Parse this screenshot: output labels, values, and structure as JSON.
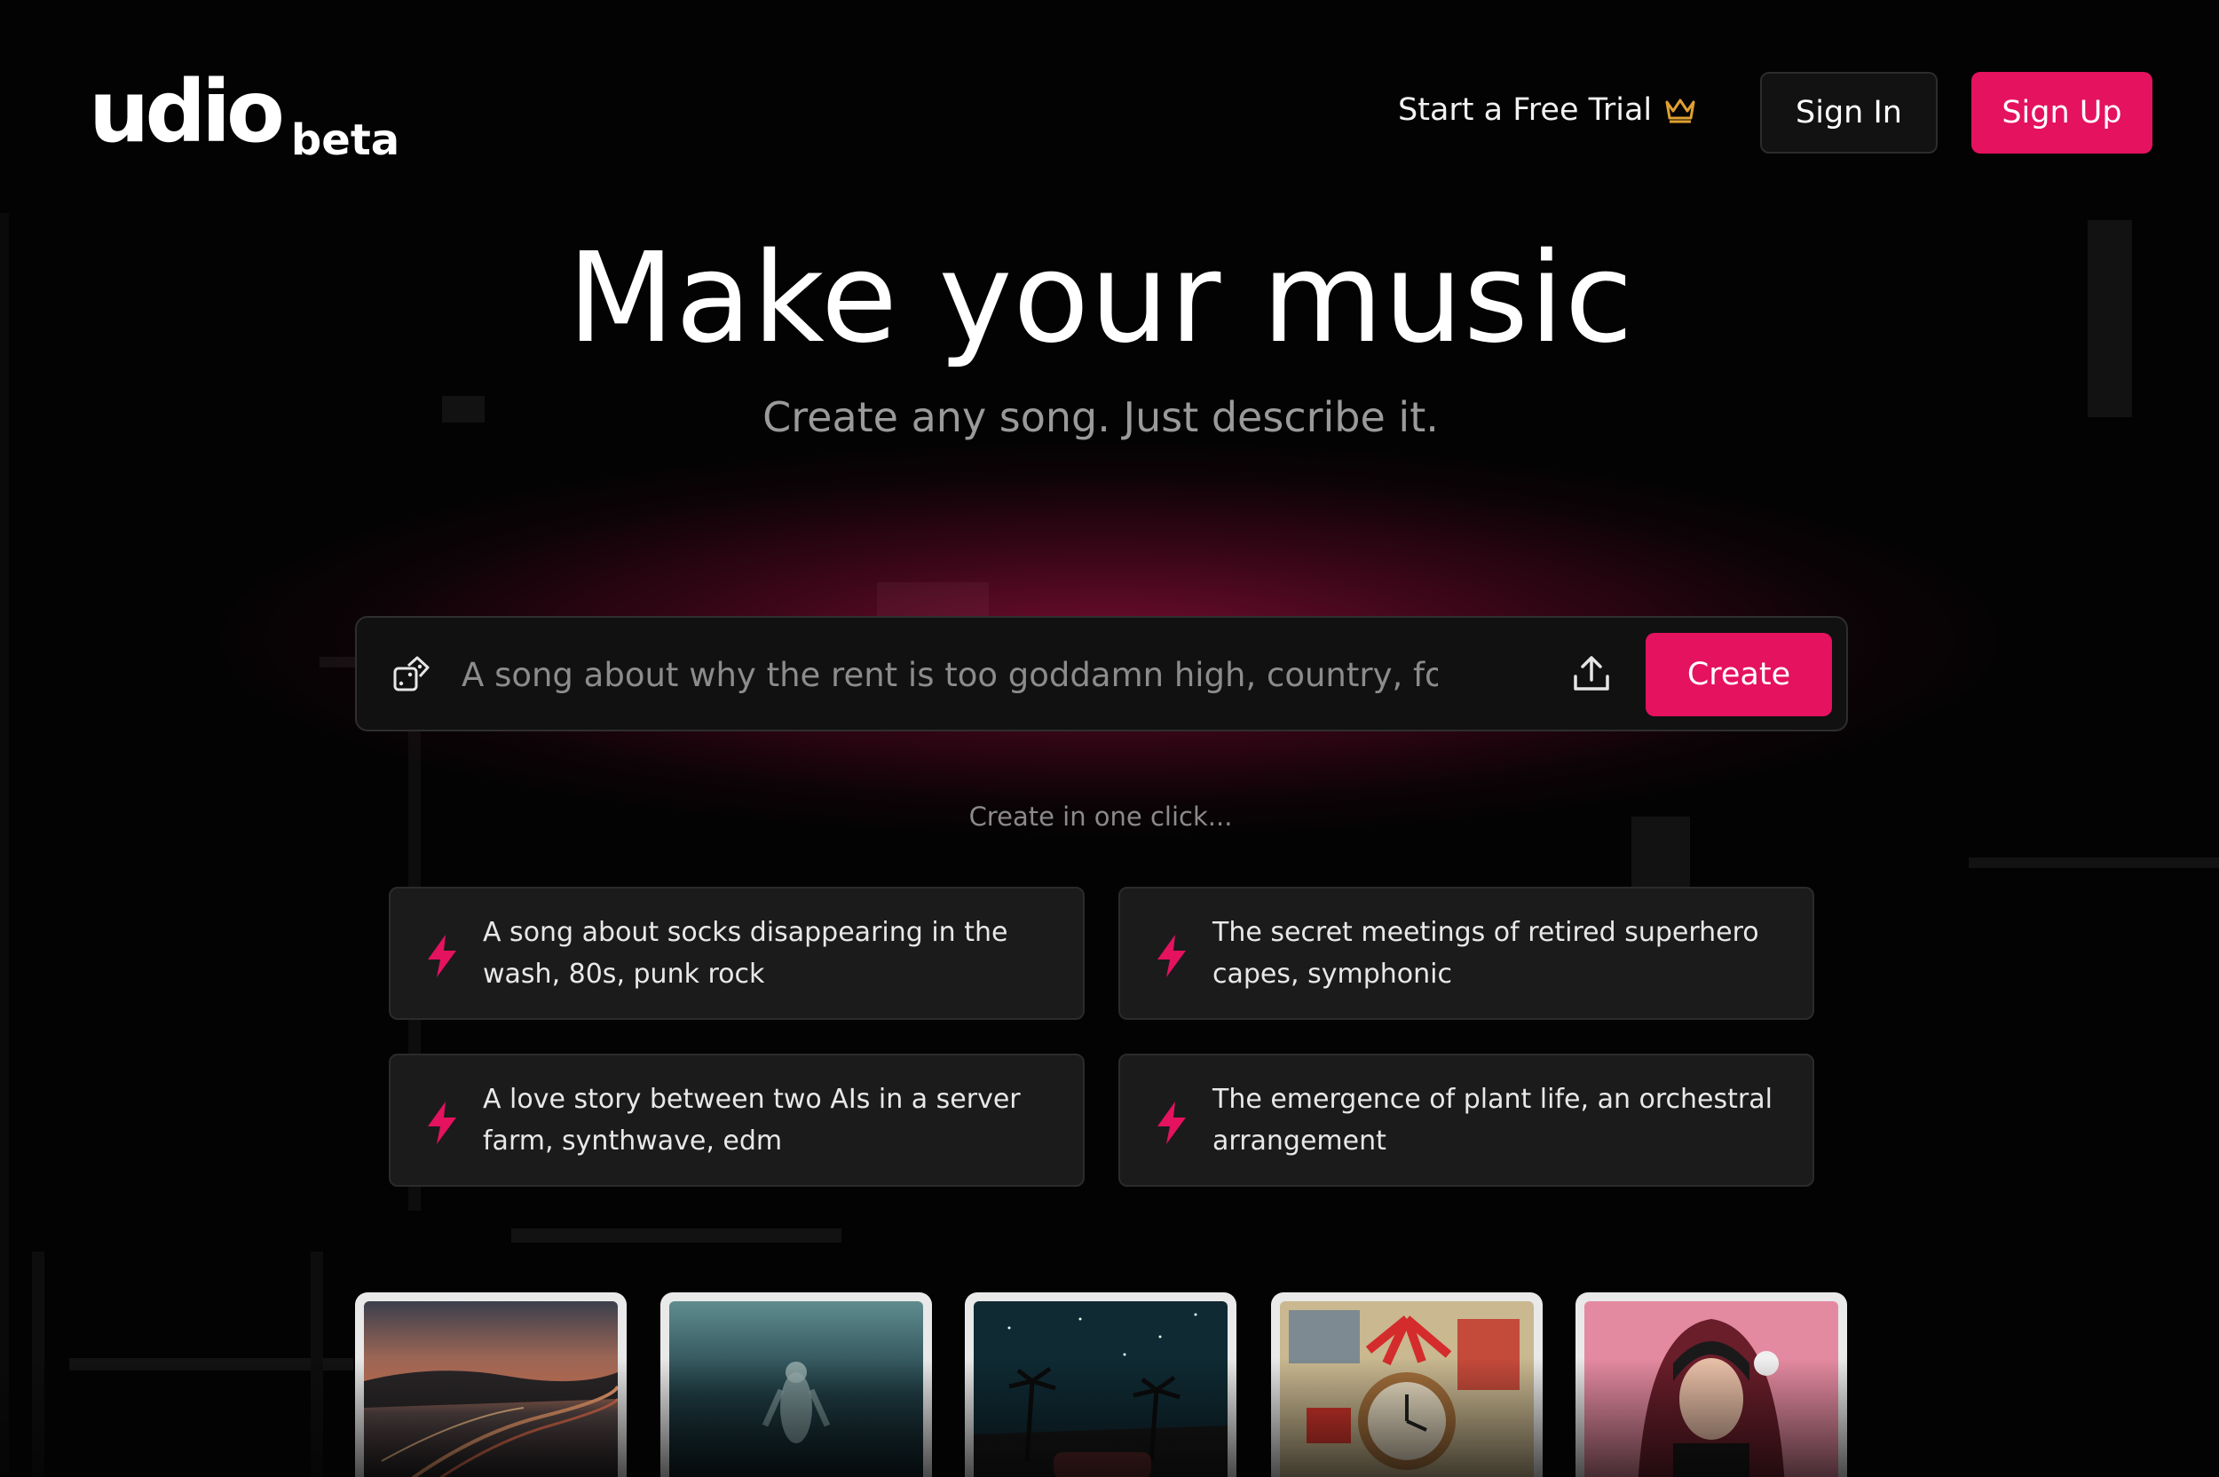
{
  "header": {
    "logo": "udio",
    "logo_tag": "beta",
    "trial_link": "Start a Free Trial",
    "sign_in": "Sign In",
    "sign_up": "Sign Up"
  },
  "hero": {
    "title": "Make your music",
    "subtitle": "Create any song. Just describe it."
  },
  "prompt": {
    "placeholder": "A song about why the rent is too goddamn high, country, folk",
    "create_label": "Create"
  },
  "suggestions": {
    "heading": "Create in one click...",
    "items": [
      {
        "text": "A song about socks disappearing in the wash, 80s, punk rock"
      },
      {
        "text": "The secret meetings of retired superhero capes, symphonic"
      },
      {
        "text": "A love story between two AIs in a server farm, synthwave, edm"
      },
      {
        "text": "The emergence of plant life, an orchestral arrangement"
      }
    ]
  },
  "thumbnails": [
    {
      "icon": "sunset-road-artwork"
    },
    {
      "icon": "underwater-figure-artwork"
    },
    {
      "icon": "palm-night-sky-artwork"
    },
    {
      "icon": "alarm-clock-collage-artwork"
    },
    {
      "icon": "pink-portrait-artwork"
    }
  ],
  "colors": {
    "accent": "#e4125f",
    "background": "#030303",
    "card": "#1b1b1b",
    "crown": "#e0a030"
  }
}
